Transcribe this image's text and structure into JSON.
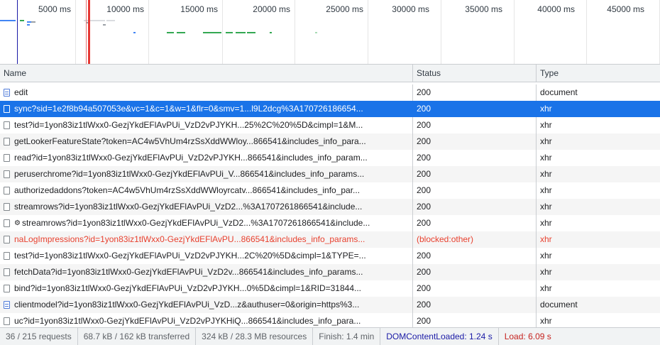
{
  "overview": {
    "ticks": [
      "5000 ms",
      "10000 ms",
      "15000 ms",
      "20000 ms",
      "25000 ms",
      "30000 ms",
      "35000 ms",
      "40000 ms",
      "45000 ms"
    ]
  },
  "columns": {
    "name": "Name",
    "status": "Status",
    "type": "Type"
  },
  "requests": [
    {
      "name": "edit",
      "status": "200",
      "type": "document",
      "icon": "document-icon"
    },
    {
      "name": "sync?sid=1e2f8b94a507053e&vc=1&c=1&w=1&flr=0&smv=1...l9L2dcg%3A170726186654...",
      "status": "200",
      "type": "xhr",
      "icon": "xhr-icon",
      "selected": true
    },
    {
      "name": "test?id=1yon83iz1tlWxx0-GezjYkdEFlAvPUi_VzD2vPJYKH...25%2C%20%5D&cimpl=1&M...",
      "status": "200",
      "type": "xhr",
      "icon": "xhr-icon"
    },
    {
      "name": "getLookerFeatureState?token=AC4w5VhUm4rzSsXddWWloy...866541&includes_info_para...",
      "status": "200",
      "type": "xhr",
      "icon": "xhr-icon"
    },
    {
      "name": "read?id=1yon83iz1tlWxx0-GezjYkdEFlAvPUi_VzD2vPJYKH...866541&includes_info_param...",
      "status": "200",
      "type": "xhr",
      "icon": "xhr-icon"
    },
    {
      "name": "peruserchrome?id=1yon83iz1tlWxx0-GezjYkdEFlAvPUi_V...866541&includes_info_params...",
      "status": "200",
      "type": "xhr",
      "icon": "xhr-icon"
    },
    {
      "name": "authorizedaddons?token=AC4w5VhUm4rzSsXddWWloyrcatv...866541&includes_info_par...",
      "status": "200",
      "type": "xhr",
      "icon": "xhr-icon"
    },
    {
      "name": "streamrows?id=1yon83iz1tlWxx0-GezjYkdEFlAvPUi_VzD2...%3A1707261866541&include...",
      "status": "200",
      "type": "xhr",
      "icon": "xhr-icon"
    },
    {
      "name": "streamrows?id=1yon83iz1tlWxx0-GezjYkdEFlAvPUi_VzD2...%3A1707261866541&include...",
      "status": "200",
      "type": "xhr",
      "icon": "xhr-icon",
      "gear": "⚙"
    },
    {
      "name": "naLogImpressions?id=1yon83iz1tlWxx0-GezjYkdEFlAvPU...866541&includes_info_params...",
      "status": "(blocked:other)",
      "type": "xhr",
      "icon": "xhr-icon",
      "error": true
    },
    {
      "name": "test?id=1yon83iz1tlWxx0-GezjYkdEFlAvPUi_VzD2vPJYKH...2C%20%5D&cimpl=1&TYPE=...",
      "status": "200",
      "type": "xhr",
      "icon": "xhr-icon"
    },
    {
      "name": "fetchData?id=1yon83iz1tlWxx0-GezjYkdEFlAvPUi_VzD2v...866541&includes_info_params...",
      "status": "200",
      "type": "xhr",
      "icon": "xhr-icon"
    },
    {
      "name": "bind?id=1yon83iz1tlWxx0-GezjYkdEFlAvPUi_VzD2vPJYKH...0%5D&cimpl=1&RID=31844...",
      "status": "200",
      "type": "xhr",
      "icon": "xhr-icon"
    },
    {
      "name": "clientmodel?id=1yon83iz1tlWxx0-GezjYkdEFlAvPUi_VzD...z&authuser=0&origin=https%3...",
      "status": "200",
      "type": "document",
      "icon": "document-icon"
    },
    {
      "name": "uc?id=1yon83iz1tlWxx0-GezjYkdEFlAvPUi_VzD2vPJYKHiQ...866541&includes_info_para...",
      "status": "200",
      "type": "xhr",
      "icon": "xhr-icon"
    }
  ],
  "status_bar": {
    "requests": "36 / 215 requests",
    "transferred": "68.7 kB / 162 kB transferred",
    "resources": "324 kB / 28.3 MB resources",
    "finish": "Finish: 1.4 min",
    "dom_content_loaded": "DOMContentLoaded: 1.24 s",
    "load": "Load: 6.09 s"
  },
  "colors": {
    "selected_row": "#1a73e8",
    "error_text": "#e8412f",
    "dcl_text": "#1a1aa6",
    "load_text": "#c5221f",
    "waterfall_green": "#34a853",
    "waterfall_blue": "#4285f4"
  }
}
